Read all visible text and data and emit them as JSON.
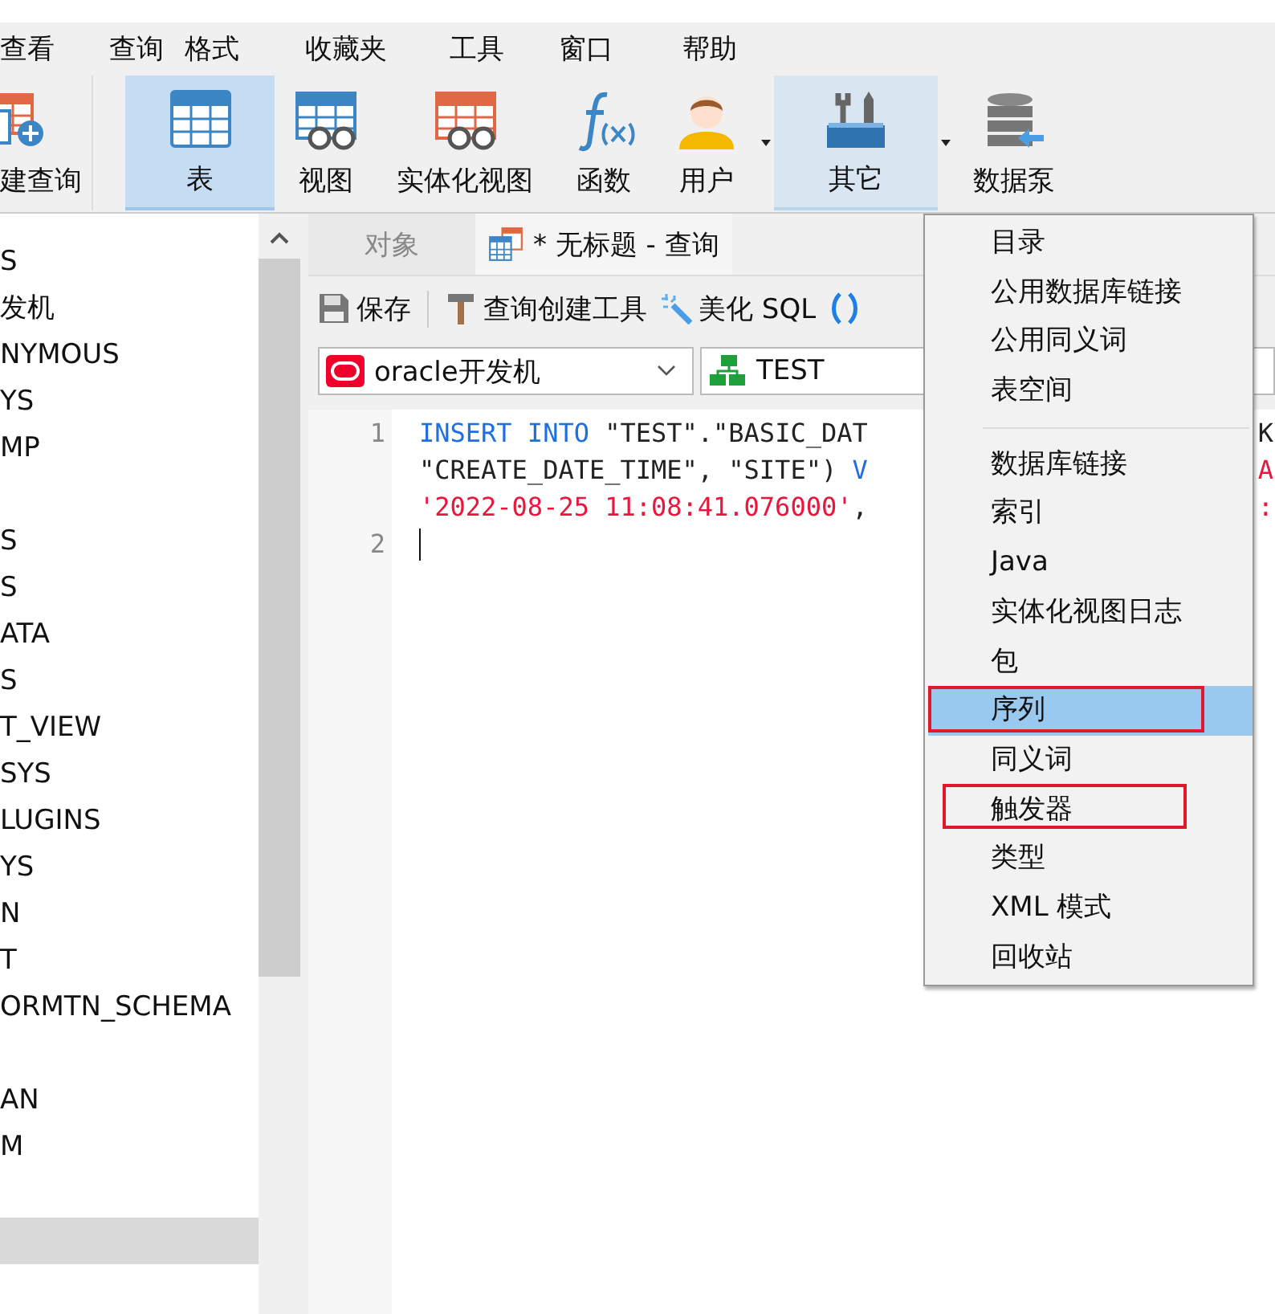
{
  "menubar": [
    {
      "label": "查看"
    },
    {
      "label": "查询"
    },
    {
      "label": "格式"
    },
    {
      "label": "收藏夹"
    },
    {
      "label": "工具"
    },
    {
      "label": "窗口"
    },
    {
      "label": "帮助"
    }
  ],
  "toolbar": [
    {
      "label": "建查询",
      "kind": "new-query",
      "selected": false,
      "expanded": false,
      "dropdown": false
    },
    {
      "label": "表",
      "kind": "table",
      "selected": true,
      "expanded": false,
      "dropdown": false
    },
    {
      "label": "视图",
      "kind": "view",
      "selected": false,
      "expanded": false,
      "dropdown": false
    },
    {
      "label": "实体化视图",
      "kind": "mview",
      "selected": false,
      "expanded": false,
      "dropdown": false
    },
    {
      "label": "函数",
      "kind": "function",
      "selected": false,
      "expanded": false,
      "dropdown": false
    },
    {
      "label": "用户",
      "kind": "user",
      "selected": false,
      "expanded": false,
      "dropdown": true
    },
    {
      "label": "其它",
      "kind": "other",
      "selected": false,
      "expanded": true,
      "dropdown": true
    },
    {
      "label": "数据泵",
      "kind": "pump",
      "selected": false,
      "expanded": false,
      "dropdown": false
    }
  ],
  "sidebar": {
    "items": [
      {
        "text": "S",
        "selected": false
      },
      {
        "text": "发机",
        "selected": false
      },
      {
        "text": "NYMOUS",
        "selected": false
      },
      {
        "text": "YS",
        "selected": false
      },
      {
        "text": "MP",
        "selected": false
      },
      {
        "selected": false
      },
      {
        "text": "S",
        "selected": false
      },
      {
        "text": "S",
        "selected": false
      },
      {
        "text": "ATA",
        "selected": false
      },
      {
        "text": "S",
        "selected": false
      },
      {
        "text": "T_VIEW",
        "selected": false
      },
      {
        "text": "SYS",
        "selected": false
      },
      {
        "text": "LUGINS",
        "selected": false
      },
      {
        "text": "YS",
        "selected": false
      },
      {
        "text": "N",
        "selected": false
      },
      {
        "text": "T",
        "selected": false
      },
      {
        "text": "ORMTN_SCHEMA",
        "selected": false
      },
      {
        "selected": false
      },
      {
        "text": "AN",
        "selected": false
      },
      {
        "text": "M",
        "selected": false
      },
      {
        "selected": false
      },
      {
        "selected": true
      }
    ]
  },
  "tabs": [
    {
      "label": "对象",
      "kind": "plain",
      "selected": false
    },
    {
      "label": "* 无标题 - 查询",
      "kind": "query",
      "selected": true
    }
  ],
  "query_toolbar": [
    {
      "label": "保存",
      "kind": "save"
    },
    {
      "label": "查询创建工具",
      "kind": "builder"
    },
    {
      "label": "美化 SQL",
      "kind": "beautify"
    },
    {
      "kind": "parens"
    }
  ],
  "selectors": [
    {
      "value": "oracle开发机",
      "kind": "connection"
    },
    {
      "value": "TEST",
      "kind": "schema"
    }
  ],
  "editor": {
    "lines": [
      {
        "number": "1",
        "rows": [
          {
            "left": [
              {
                "text": "INSERT INTO",
                "kind": "keyword"
              },
              {
                "text": " \"TEST\".\"BASIC_DAT",
                "kind": "plain"
              }
            ],
            "right": [
              {
                "text": "K",
                "kind": "plain"
              }
            ]
          },
          {
            "left": [
              {
                "text": "\"CREATE_DATE_TIME\", \"SITE\") ",
                "kind": "plain"
              },
              {
                "text": "V",
                "kind": "keyword"
              }
            ],
            "right": [
              {
                "text": "A",
                "kind": "string"
              }
            ]
          },
          {
            "left": [
              {
                "text": "'2022-08-25 11:08:41.076000'",
                "kind": "string"
              },
              {
                "text": ",",
                "kind": "plain"
              }
            ],
            "right": [
              {
                "text": ":",
                "kind": "string"
              }
            ]
          }
        ]
      },
      {
        "number": "2",
        "cursor": true
      }
    ]
  },
  "menu": {
    "items": [
      {
        "kind": "item",
        "label": "目录",
        "selected": false,
        "annotated": false
      },
      {
        "kind": "item",
        "label": "公用数据库链接",
        "selected": false,
        "annotated": false
      },
      {
        "kind": "item",
        "label": "公用同义词",
        "selected": false,
        "annotated": false
      },
      {
        "kind": "item",
        "label": "表空间",
        "selected": false,
        "annotated": false
      },
      {
        "kind": "separator"
      },
      {
        "kind": "item",
        "label": "数据库链接",
        "selected": false,
        "annotated": false
      },
      {
        "kind": "item",
        "label": "索引",
        "selected": false,
        "annotated": false
      },
      {
        "kind": "item",
        "label": "Java",
        "selected": false,
        "annotated": false
      },
      {
        "kind": "item",
        "label": "实体化视图日志",
        "selected": false,
        "annotated": false
      },
      {
        "kind": "item",
        "label": "包",
        "selected": false,
        "annotated": false
      },
      {
        "kind": "item",
        "label": "序列",
        "selected": true,
        "annotated": true
      },
      {
        "kind": "item",
        "label": "同义词",
        "selected": false,
        "annotated": false
      },
      {
        "kind": "item",
        "label": "触发器",
        "selected": false,
        "annotated": true
      },
      {
        "kind": "item",
        "label": "类型",
        "selected": false,
        "annotated": false
      },
      {
        "kind": "item",
        "label": "XML 模式",
        "selected": false,
        "annotated": false
      },
      {
        "kind": "item",
        "label": "回收站",
        "selected": false,
        "annotated": false
      }
    ]
  }
}
